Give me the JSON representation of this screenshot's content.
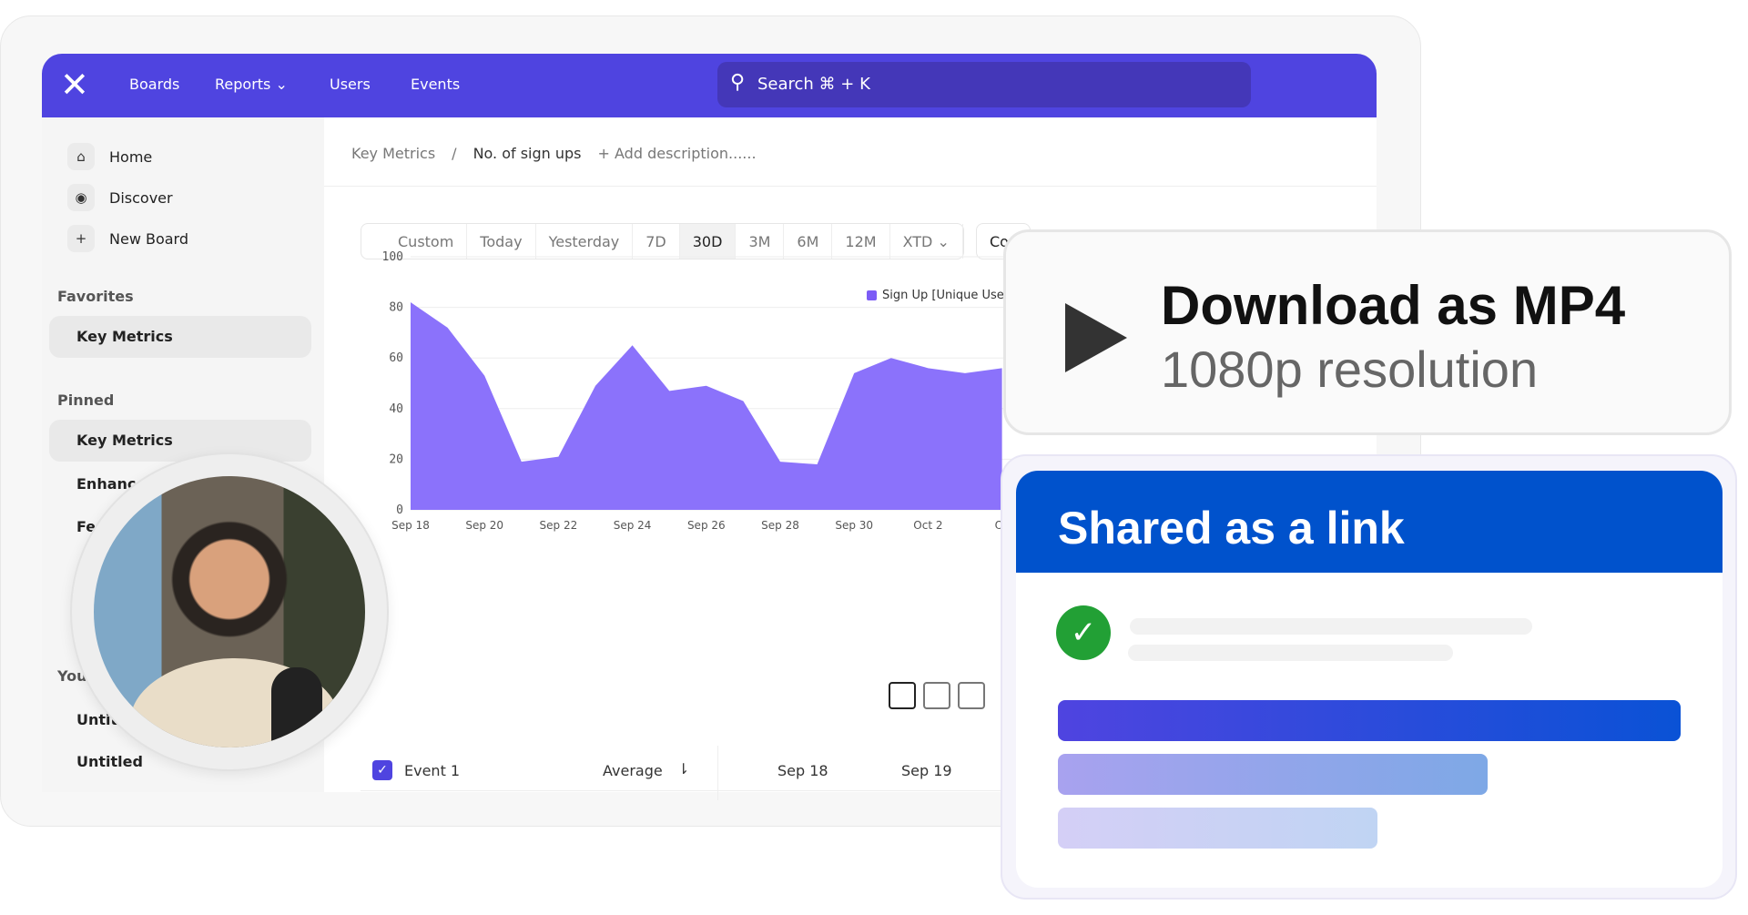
{
  "nav": {
    "logo": "x-logo",
    "items": [
      "Boards",
      "Reports",
      "Users",
      "Events"
    ],
    "search_label": "Search ⌘ + K",
    "accent": "#4f44e0"
  },
  "sidebar": {
    "items": [
      {
        "icon": "home-icon",
        "label": "Home"
      },
      {
        "icon": "compass-icon",
        "label": "Discover"
      },
      {
        "icon": "plus-icon",
        "label": "New Board"
      }
    ],
    "favorites_label": "Favorites",
    "favorites": [
      "Key Metrics"
    ],
    "pinned_label": "Pinned",
    "pinned": [
      "Key Metrics",
      "Enhance",
      "Fe"
    ],
    "yours_label": "You",
    "yours": [
      "Untit",
      "Untitled"
    ]
  },
  "breadcrumb": {
    "parent": "Key Metrics",
    "sep": "/",
    "current": "No. of sign ups",
    "add": "+ Add description......"
  },
  "ranges": {
    "items": [
      "Custom",
      "Today",
      "Yesterday",
      "7D",
      "30D",
      "3M",
      "6M",
      "12M",
      "XTD ⌄"
    ],
    "selected": "30D",
    "compare": "Co"
  },
  "chart_data": {
    "type": "area",
    "legend": "Sign Up [Unique Use",
    "color": "#8b72fb",
    "ylim": [
      0,
      100
    ],
    "yticks": [
      "100",
      "80",
      "60",
      "40",
      "20",
      "0"
    ],
    "xticks": [
      "Sep 18",
      "Sep 20",
      "Sep 22",
      "Sep 24",
      "Sep 26",
      "Sep 28",
      "Sep 30",
      "Oct 2",
      "Oc"
    ],
    "x": [
      "Sep 18",
      "Sep 19",
      "Sep 20",
      "Sep 21",
      "Sep 22",
      "Sep 23",
      "Sep 24",
      "Sep 25",
      "Sep 26",
      "Sep 27",
      "Sep 28",
      "Sep 29",
      "Sep 30",
      "Oct 1",
      "Oct 2",
      "Oct 3",
      "Oct 4"
    ],
    "values": [
      82,
      72,
      53,
      19,
      21,
      49,
      65,
      47,
      49,
      43,
      19,
      18,
      54,
      60,
      56,
      54,
      56
    ]
  },
  "table": {
    "event": "Event 1",
    "avg": "Average",
    "cols": [
      "Sep 18",
      "Sep 19"
    ]
  },
  "download": {
    "title": "Download as MP4",
    "subtitle": "1080p resolution"
  },
  "share": {
    "title": "Shared as a link",
    "header_color": "#0052cc"
  }
}
